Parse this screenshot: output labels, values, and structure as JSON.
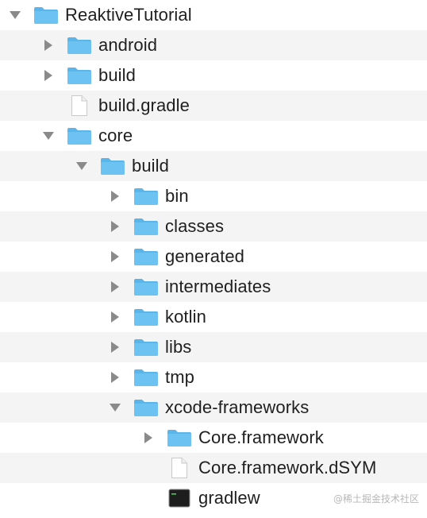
{
  "tree": [
    {
      "label": "ReaktiveTutorial",
      "depth": 0,
      "type": "folder",
      "state": "expanded"
    },
    {
      "label": "android",
      "depth": 1,
      "type": "folder",
      "state": "collapsed"
    },
    {
      "label": "build",
      "depth": 1,
      "type": "folder",
      "state": "collapsed"
    },
    {
      "label": "build.gradle",
      "depth": 1,
      "type": "file",
      "state": "none"
    },
    {
      "label": "core",
      "depth": 1,
      "type": "folder",
      "state": "expanded"
    },
    {
      "label": "build",
      "depth": 2,
      "type": "folder",
      "state": "expanded"
    },
    {
      "label": "bin",
      "depth": 3,
      "type": "folder",
      "state": "collapsed"
    },
    {
      "label": "classes",
      "depth": 3,
      "type": "folder",
      "state": "collapsed"
    },
    {
      "label": "generated",
      "depth": 3,
      "type": "folder",
      "state": "collapsed"
    },
    {
      "label": "intermediates",
      "depth": 3,
      "type": "folder",
      "state": "collapsed"
    },
    {
      "label": "kotlin",
      "depth": 3,
      "type": "folder",
      "state": "collapsed"
    },
    {
      "label": "libs",
      "depth": 3,
      "type": "folder",
      "state": "collapsed"
    },
    {
      "label": "tmp",
      "depth": 3,
      "type": "folder",
      "state": "collapsed"
    },
    {
      "label": "xcode-frameworks",
      "depth": 3,
      "type": "folder",
      "state": "expanded"
    },
    {
      "label": "Core.framework",
      "depth": 4,
      "type": "folder",
      "state": "collapsed"
    },
    {
      "label": "Core.framework.dSYM",
      "depth": 4,
      "type": "file",
      "state": "none"
    },
    {
      "label": "gradlew",
      "depth": 4,
      "type": "terminal",
      "state": "none"
    }
  ],
  "watermark": "@稀土掘金技术社区",
  "colors": {
    "folder": "#6cc3f2",
    "folder_tab": "#5ab6ea",
    "triangle": "#8a8a8a",
    "row_alt": "#f4f4f5"
  }
}
